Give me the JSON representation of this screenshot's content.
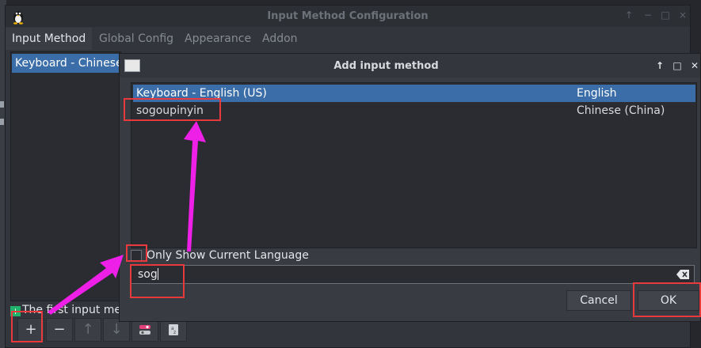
{
  "main_window": {
    "title": "Input Method Configuration",
    "tabs": [
      "Input Method",
      "Global Config",
      "Appearance",
      "Addon"
    ],
    "active_tab": "Input Method",
    "im_list": [
      "Keyboard - Chinese"
    ],
    "hint": "The first input meth",
    "toolbar": [
      "add",
      "remove",
      "move-up",
      "move-down",
      "configure",
      "keyboard-layout"
    ]
  },
  "dialog": {
    "title": "Add input method",
    "columns": [
      "name",
      "language"
    ],
    "rows": [
      {
        "name": "Keyboard - English (US)",
        "language": "English",
        "selected": true
      },
      {
        "name": "sogoupinyin",
        "language": "Chinese (China)",
        "selected": false
      }
    ],
    "only_show_current_language": {
      "label": "Only Show Current Language",
      "checked": false
    },
    "search": {
      "value": "sog"
    },
    "buttons": {
      "cancel": "Cancel",
      "ok": "OK"
    }
  },
  "colors": {
    "selection": "#3b6ea8",
    "annotation_box": "#e8393d",
    "annotation_arrow": "#ee1fe6"
  }
}
